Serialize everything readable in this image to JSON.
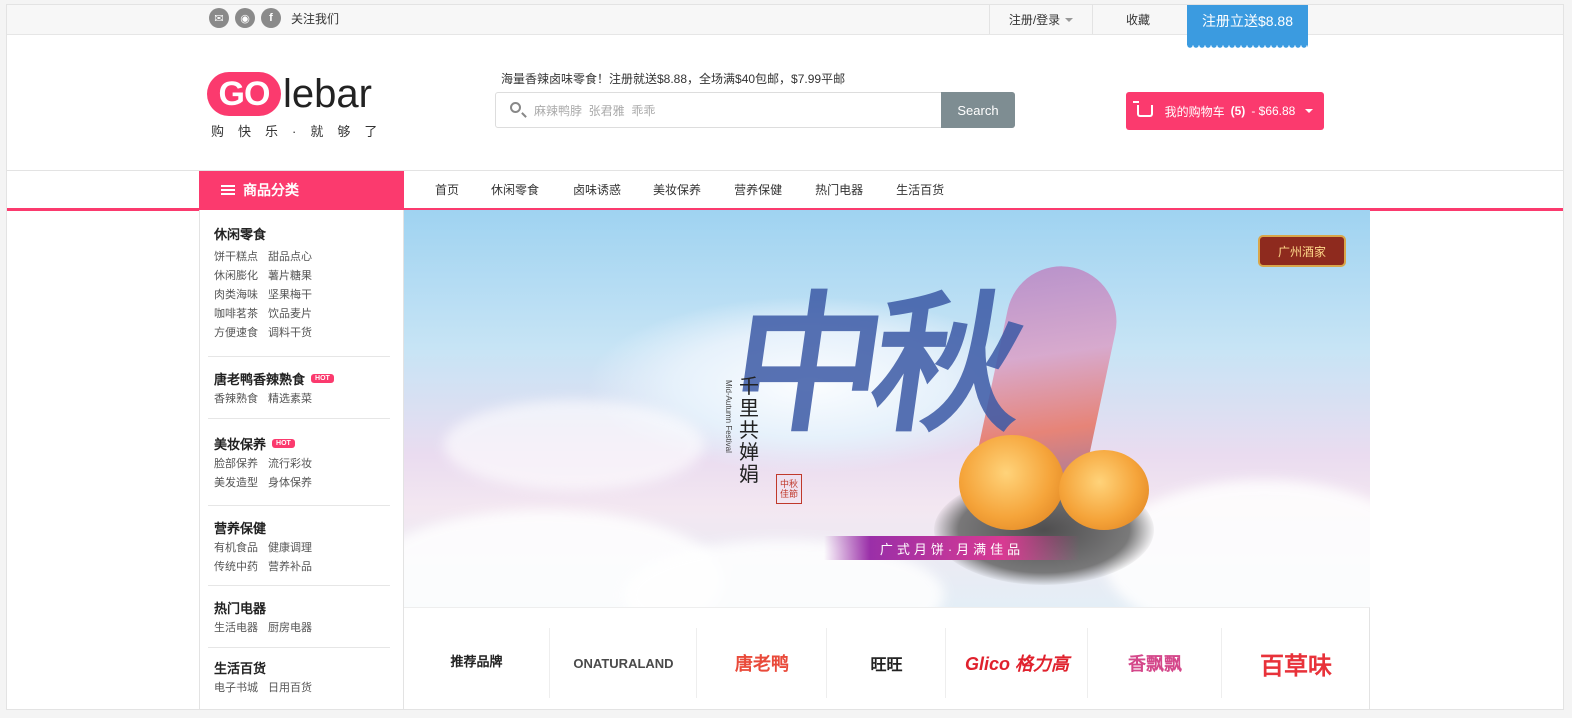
{
  "topbar": {
    "follow_label": "关注我们",
    "social_icons": [
      "wechat-icon",
      "weibo-icon",
      "facebook-icon"
    ],
    "login_label": "注册/登录",
    "favorite_label": "收藏",
    "register_bonus_label": "注册立送$8.88"
  },
  "logo": {
    "go": "GO",
    "rest": "lebar",
    "slogan": "购快乐·就够了"
  },
  "header": {
    "promo_text": "海量香辣卤味零食！注册就送$8.88，全场满$40包邮，$7.99平邮",
    "search_placeholder": "麻辣鸭脖  张君雅  乖乖",
    "search_button": "Search",
    "cart_label": "我的购物车",
    "cart_count": "(5)",
    "cart_total": "- $66.88"
  },
  "nav": {
    "category_button": "商品分类",
    "links": [
      "首页",
      "休闲零食",
      "卤味诱惑",
      "美妆保养",
      "营养保健",
      "热门电器",
      "生活百货"
    ]
  },
  "sidebar": {
    "hot_badge": "HOT",
    "groups": [
      {
        "title": "休闲零食",
        "rows": [
          [
            "饼干糕点",
            "甜品点心"
          ],
          [
            "休闲膨化",
            "薯片糖果"
          ],
          [
            "肉类海味",
            "坚果梅干"
          ],
          [
            "咖啡茗茶",
            "饮品麦片"
          ],
          [
            "方便速食",
            "调料干货"
          ]
        ]
      },
      {
        "title": "唐老鸭香辣熟食",
        "hot": true,
        "rows": [
          [
            "香辣熟食",
            "精选素菜"
          ]
        ]
      },
      {
        "title": "美妆保养",
        "hot": true,
        "rows": [
          [
            "脸部保养",
            "流行彩妆"
          ],
          [
            "美发造型",
            "身体保养"
          ]
        ]
      },
      {
        "title": "营养保健",
        "rows": [
          [
            "有机食品",
            "健康调理"
          ],
          [
            "传统中药",
            "营养补品"
          ]
        ]
      },
      {
        "title": "热门电器",
        "rows": [
          [
            "生活电器",
            "厨房电器"
          ]
        ]
      },
      {
        "title": "生活百货",
        "rows": [
          [
            "电子书城",
            "日用百货"
          ]
        ]
      }
    ]
  },
  "banner": {
    "calligraphy": "中秋",
    "vertical_text": "千里共婵娟",
    "vertical_en": "Mid-Autumn Festival",
    "seal_text": "中秋佳節",
    "tagline": "广式月饼·月满佳品",
    "brand_badge": "广州酒家",
    "colors": {
      "sky": "#9fd3f1",
      "accent": "#d83a92"
    }
  },
  "brands": {
    "title": "推荐品牌",
    "items": [
      {
        "name": "ONATURALAND",
        "color": "#4a4a4a"
      },
      {
        "name": "唐老鸭",
        "color": "#e94a3a"
      },
      {
        "name": "旺旺",
        "color": "#222222"
      },
      {
        "name": "Glico 格力高",
        "color": "#e0212d"
      },
      {
        "name": "香飘飘",
        "color": "#d4478a"
      },
      {
        "name": "百草味",
        "color": "#e8323a"
      }
    ]
  },
  "theme": {
    "primary": "#fb3a6e",
    "blue": "#3b9be0",
    "search_btn": "#7e8d92"
  }
}
